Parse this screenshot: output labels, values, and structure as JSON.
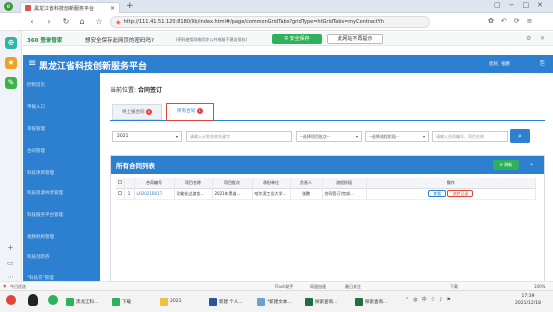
{
  "browser": {
    "tab_title": "黑龙江省科技创新服务平台",
    "url": "http://111.41.51.120:8180/lib/index.html#/page/commonGridTabs?gridType=htGridTabs=myContractYh"
  },
  "infobar": {
    "brand": "360 登录管家",
    "question": "想安全保存此网页的密码吗?",
    "note": "(密码使用网络同步公共电脑下建议保存)",
    "save_label": "安全保存",
    "never_label": "此网站不再提示"
  },
  "app": {
    "title": "黑龙江省科技创新服务平台",
    "user": "您好, 张鹏",
    "menu": [
      "控制首页",
      "申报入口",
      "审核管理",
      "合同管理",
      "科技项目管理",
      "科技资源共享管理",
      "科技服务平台管理",
      "视频机构管理",
      "科技创新券",
      "\"科技贷\"管理"
    ]
  },
  "breadcrumb": {
    "prefix": "当前位置:",
    "current": "合同签订"
  },
  "tabs": [
    {
      "label": "待上报合同",
      "badge": "0"
    },
    {
      "label": "所有合同",
      "badge": "1"
    }
  ],
  "filters": {
    "year": "2021",
    "keyword_placeholder": "请输入计划名称关键字",
    "batch_placeholder": "--选择项目批次--",
    "stage_placeholder": "--选择流程阶段--",
    "number_placeholder": "请输入合同编号、项目名称"
  },
  "panel": {
    "title": "所有合同列表",
    "refresh_label": "刷新"
  },
  "table": {
    "headers": [
      "合同编号",
      "项目名称",
      "项目批次",
      "承担单位",
      "负责人",
      "流程阶段",
      "操作"
    ],
    "rows": [
      {
        "num": "1",
        "contract": "LH2021B017",
        "name": "功能化过渡金...",
        "batch": "2021年黑省...",
        "unit": "哈尔滨工业大学...",
        "owner": "张鹏",
        "stage": "合同签订(完成...",
        "view": "查看",
        "process": "流转记录"
      }
    ]
  },
  "taskbar": {
    "flash": "Flash助手",
    "speed": "网速加速",
    "hotspot": "最日关注",
    "download": "下载",
    "zoom": "100%",
    "today": "今日优选",
    "items": [
      "黑龙江科...",
      "下载",
      "2021",
      "新建 个人...",
      "*新建文本...",
      "探索查询...",
      "探索查询..."
    ],
    "time": "17:39",
    "date": "2021/12/18"
  },
  "colors": {
    "primary": "#2d7fcf",
    "accent_red": "#e0463a",
    "green": "#2fb05a"
  }
}
